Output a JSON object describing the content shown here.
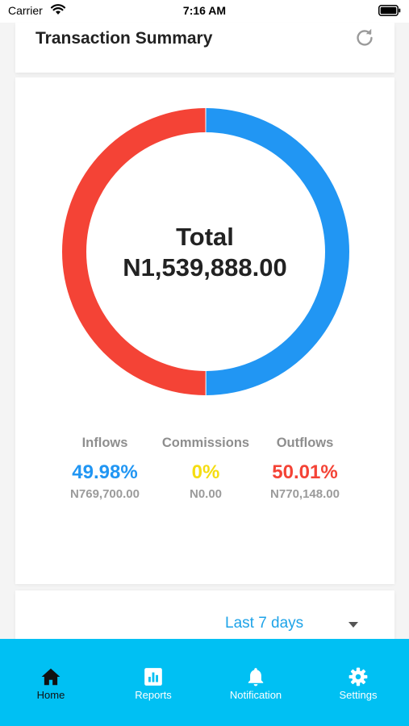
{
  "status_bar": {
    "carrier": "Carrier",
    "time": "7:16 AM",
    "wifi_icon": "wifi-icon",
    "battery_icon": "battery-icon"
  },
  "header": {
    "title": "Transaction Summary",
    "refresh_icon": "refresh-icon"
  },
  "summary": {
    "total_label": "Total",
    "total_amount": "N1,539,888.00",
    "stats": {
      "inflows": {
        "label": "Inflows",
        "percent": "49.98%",
        "amount": "N769,700.00",
        "color": "#2196f3"
      },
      "commissions": {
        "label": "Commissions",
        "percent": "0%",
        "amount": "N0.00",
        "color": "#f5dd12"
      },
      "outflows": {
        "label": "Outflows",
        "percent": "50.01%",
        "amount": "N770,148.00",
        "color": "#f44336"
      }
    }
  },
  "chart_data": {
    "type": "pie",
    "categories": [
      "Inflows",
      "Commissions",
      "Outflows"
    ],
    "values": [
      769700.0,
      0.0,
      770148.0
    ],
    "colors": [
      "#2196f3",
      "#f5dd12",
      "#f44336"
    ],
    "title": "Total",
    "subtitle": "N1,539,888.00"
  },
  "filter": {
    "period": "Last 7 days",
    "dropdown_icon": "caret-down-icon"
  },
  "tab_bar": {
    "tabs": [
      {
        "label": "Home",
        "icon": "home-icon",
        "active": true
      },
      {
        "label": "Reports",
        "icon": "reports-icon",
        "active": false
      },
      {
        "label": "Notification",
        "icon": "bell-icon",
        "active": false
      },
      {
        "label": "Settings",
        "icon": "gear-icon",
        "active": false
      }
    ],
    "background": "#00c0f3"
  }
}
